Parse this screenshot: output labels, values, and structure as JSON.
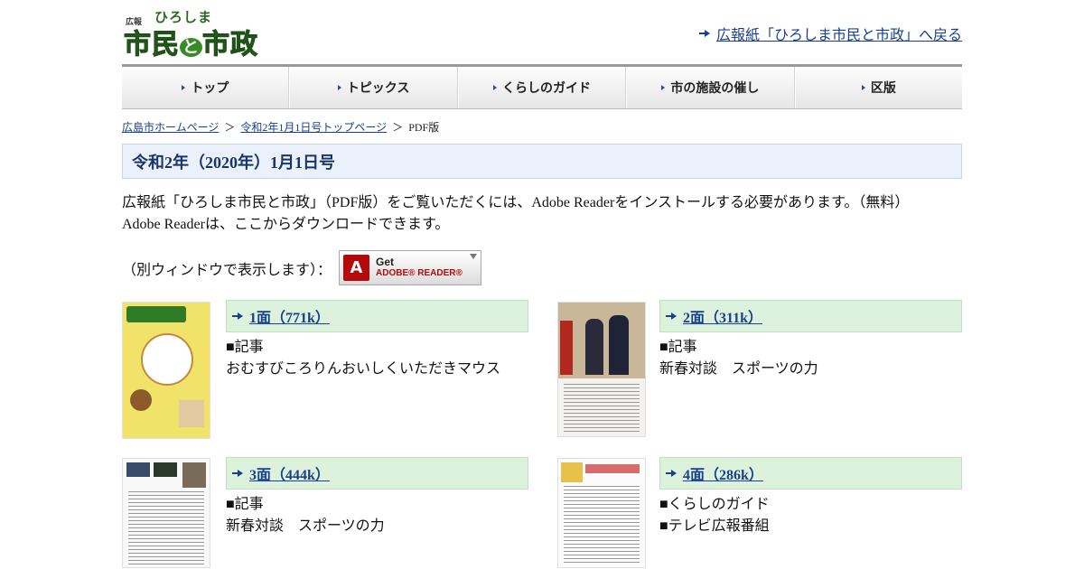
{
  "header": {
    "logo_small": "広報",
    "logo_top": "ひろしま",
    "logo_main_a": "市民",
    "logo_main_to": "と",
    "logo_main_b": "市政",
    "back_link": "広報紙「ひろしま市民と市政」へ戻る"
  },
  "nav": {
    "items": [
      {
        "label": "トップ"
      },
      {
        "label": "トピックス"
      },
      {
        "label": "くらしのガイド"
      },
      {
        "label": "市の施設の催し"
      },
      {
        "label": "区版"
      }
    ]
  },
  "breadcrumb": {
    "home": "広島市ホームページ",
    "sep": "＞",
    "issue_top": "令和2年1月1日号トップページ",
    "current": "PDF版"
  },
  "title": "令和2年（2020年）1月1日号",
  "intro": {
    "line1": "広報紙「ひろしま市民と市政」（PDF版）をご覧いただくには、Adobe Readerをインストールする必要があります。（無料）",
    "line2": "Adobe Readerは、ここからダウンロードできます。"
  },
  "reader": {
    "label": "（別ウィンドウで表示します）：",
    "btn_get": "Get",
    "btn_brand": "ADOBE® READER®",
    "pdf_glyph": "A"
  },
  "pages": [
    {
      "link": "1面（771k）",
      "lines": [
        "■記事",
        "おむすびころりんおいしくいただきマウス"
      ]
    },
    {
      "link": "2面（311k）",
      "lines": [
        "■記事",
        "新春対談　スポーツの力"
      ]
    },
    {
      "link": "3面（444k）",
      "lines": [
        "■記事",
        "新春対談　スポーツの力"
      ]
    },
    {
      "link": "4面（286k）",
      "lines": [
        "■くらしのガイド",
        "■テレビ広報番組"
      ]
    }
  ],
  "colors": {
    "accent": "#1a3f8f",
    "title_bg": "#eaf1fb",
    "page_head_bg": "#dcf2dc"
  }
}
